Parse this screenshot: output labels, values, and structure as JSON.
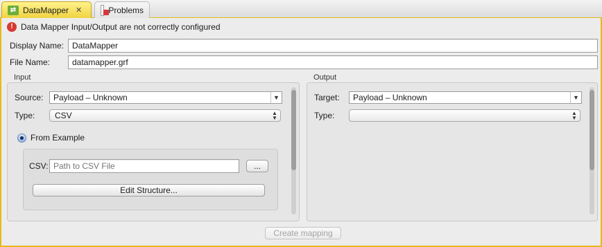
{
  "tabs": [
    {
      "label": "DataMapper",
      "icon": "datamapper-icon",
      "active": true
    },
    {
      "label": "Problems",
      "icon": "problems-icon",
      "active": false
    }
  ],
  "error": {
    "message": "Data Mapper Input/Output are not correctly configured"
  },
  "fields": {
    "display_name": {
      "label": "Display Name:",
      "value": "DataMapper"
    },
    "file_name": {
      "label": "File Name:",
      "value": "datamapper.grf"
    }
  },
  "input": {
    "title": "Input",
    "source": {
      "label": "Source:",
      "value": "Payload – Unknown"
    },
    "type": {
      "label": "Type:",
      "value": "CSV"
    },
    "from_example": {
      "label": "From Example",
      "selected": true
    },
    "csv": {
      "label": "CSV:",
      "placeholder": "Path to CSV File",
      "browse_label": "..."
    },
    "edit_structure_label": "Edit Structure..."
  },
  "output": {
    "title": "Output",
    "target": {
      "label": "Target:",
      "value": "Payload – Unknown"
    },
    "type": {
      "label": "Type:",
      "value": ""
    }
  },
  "create_mapping_label": "Create mapping",
  "colors": {
    "accent": "#e7b91b",
    "error": "#d63a32"
  }
}
